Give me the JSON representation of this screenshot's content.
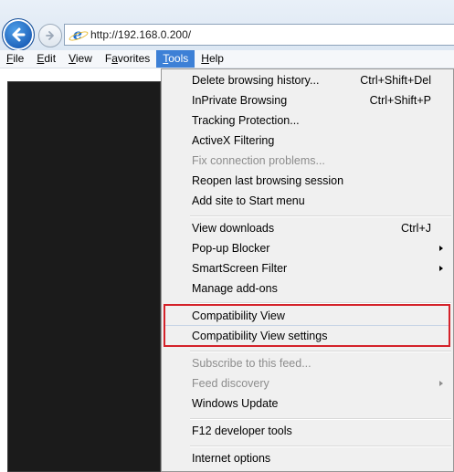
{
  "address_bar": {
    "url": "http://192.168.0.200/"
  },
  "menubar": {
    "items": [
      {
        "pre": "",
        "mn": "F",
        "post": "ile"
      },
      {
        "pre": "",
        "mn": "E",
        "post": "dit"
      },
      {
        "pre": "",
        "mn": "V",
        "post": "iew"
      },
      {
        "pre": "F",
        "mn": "a",
        "post": "vorites"
      },
      {
        "pre": "",
        "mn": "T",
        "post": "ools"
      },
      {
        "pre": "",
        "mn": "H",
        "post": "elp"
      }
    ],
    "active_item": "Tools"
  },
  "tools_menu": {
    "items": [
      {
        "label": "Delete browsing history...",
        "shortcut": "Ctrl+Shift+Del"
      },
      {
        "label": "InPrivate Browsing",
        "shortcut": "Ctrl+Shift+P"
      },
      {
        "label": "Tracking Protection..."
      },
      {
        "label": "ActiveX Filtering"
      },
      {
        "label": "Fix connection problems...",
        "disabled": true
      },
      {
        "label": "Reopen last browsing session"
      },
      {
        "label": "Add site to Start menu"
      },
      {
        "label": "View downloads",
        "shortcut": "Ctrl+J"
      },
      {
        "label": "Pop-up Blocker",
        "submenu": true
      },
      {
        "label": "SmartScreen Filter",
        "submenu": true
      },
      {
        "label": "Manage add-ons"
      },
      {
        "label": "Compatibility View",
        "highlighted": true
      },
      {
        "label": "Compatibility View settings",
        "highlighted": true
      },
      {
        "label": "Subscribe to this feed...",
        "disabled": true
      },
      {
        "label": "Feed discovery",
        "disabled": true,
        "submenu": true
      },
      {
        "label": "Windows Update"
      },
      {
        "label": "F12 developer tools"
      },
      {
        "label": "Internet options"
      }
    ]
  },
  "colors": {
    "menu_active_bg": "#3d80d6",
    "highlight_border": "#d4222a",
    "disabled_text": "#8d8d8d",
    "page_dark": "#1b1b1b"
  }
}
